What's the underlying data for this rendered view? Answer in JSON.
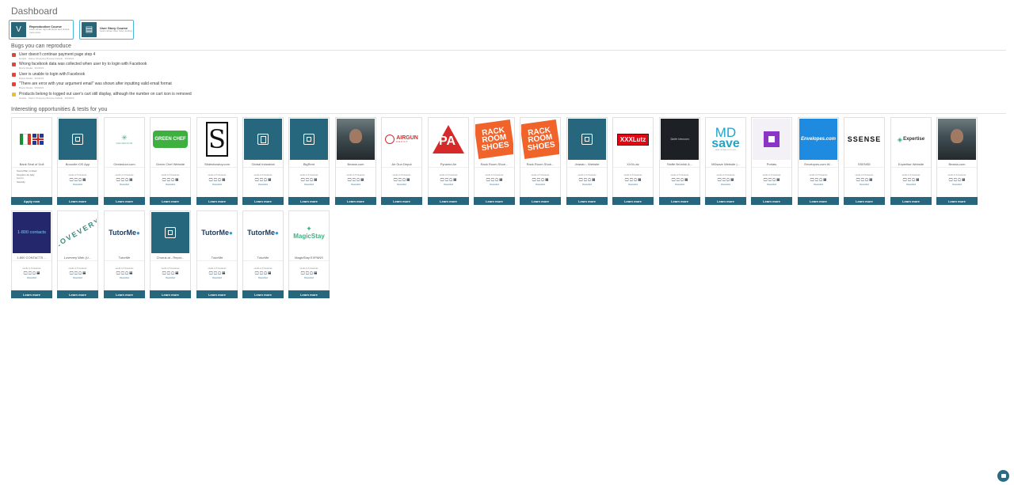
{
  "page": {
    "title": "Dashboard"
  },
  "courses": [
    {
      "name": "Reproduction Course",
      "desc": "Learn about reproductions and unlock more tests",
      "icon": "v-logo-icon"
    },
    {
      "name": "User Story Course",
      "desc": "Learn about User Story testing",
      "icon": "id-card-icon"
    }
  ],
  "bugs_section": {
    "heading": "Bugs you can reproduce",
    "items": [
      {
        "text": "User doesn't continue payment page step 4",
        "meta": "Details · Native Shopping Browse Default · 6/6/2023",
        "severity": "red"
      },
      {
        "text": "Wrong facebook data was collected when user try to login with Facebook",
        "meta": "Brand Media · 6/6/2023",
        "severity": "red"
      },
      {
        "text": "User is unable to login with Facebook",
        "meta": "Brand Media · 6/6/2023",
        "severity": "red"
      },
      {
        "text": "\"There are error with your argument email\" was shown after inputting valid email format",
        "meta": "Brand Media · 6/6/2023",
        "severity": "red"
      },
      {
        "text": "Products belong to logged out user's cart still display, although the number on cart icon is removed",
        "meta": "Details · Native Shopping Browse Default · 6/6/2023",
        "severity": "yellow"
      }
    ]
  },
  "opportunities_section": {
    "heading": "Interesting opportunities & tests for you",
    "tiles": [
      {
        "name": "Bank Seal of Doll",
        "logo": "flags",
        "button": "Apply now"
      },
      {
        "name": "Booodle iOS App",
        "logo": "placeholder",
        "button": "Learn more"
      },
      {
        "name": "Geniedoor.com",
        "logo": "geniedoor",
        "button": "Learn more"
      },
      {
        "name": "Green Chef Website",
        "logo": "greenchef",
        "button": "Learn more"
      },
      {
        "name": "Slideshowtoy.com",
        "logo": "s",
        "button": "Learn more"
      },
      {
        "name": "Global Industrial",
        "logo": "placeholder2",
        "button": "Learn more"
      },
      {
        "name": "BigRent",
        "logo": "placeholder",
        "button": "Learn more"
      },
      {
        "name": "Beaxia.com",
        "logo": "photo",
        "button": "Learn more"
      },
      {
        "name": "Air Gun Depot",
        "logo": "airgun",
        "button": "Learn more"
      },
      {
        "name": "Pyramid Air",
        "logo": "pyramid",
        "button": "Learn more"
      },
      {
        "name": "Rack Room Shoe...",
        "logo": "rackroom",
        "button": "Learn more"
      },
      {
        "name": "Rack Room Shoe...",
        "logo": "rackroom",
        "button": "Learn more"
      },
      {
        "name": "Jeanau - Website",
        "logo": "placeholder",
        "button": "Learn more"
      },
      {
        "name": "XXXLutz",
        "logo": "xxxlutz",
        "button": "Learn more"
      },
      {
        "name": "Stoffe Brünink &...",
        "logo": "stoffe",
        "button": "Learn more"
      },
      {
        "name": "MDsave Website |...",
        "logo": "mdsave",
        "button": "Learn more"
      },
      {
        "name": "Portals",
        "logo": "portals",
        "button": "Learn more"
      },
      {
        "name": "Envelopes.com W...",
        "logo": "envelopes",
        "button": "Learn more"
      },
      {
        "name": "SSENSE",
        "logo": "ssense",
        "button": "Learn more"
      },
      {
        "name": "Expertise Website",
        "logo": "expertise",
        "button": "Learn more"
      },
      {
        "name": "Beaxia.com",
        "logo": "photo",
        "button": "Learn more"
      },
      {
        "name": "1-800 CONTACTS ...",
        "logo": "contacts",
        "button": "Learn more"
      },
      {
        "name": "Lovevery Web (U...",
        "logo": "lovevery",
        "button": "Learn more"
      },
      {
        "name": "TutorMe",
        "logo": "tutorme",
        "button": "Learn more"
      },
      {
        "name": "Chorus.ai - Repor...",
        "logo": "placeholder",
        "button": "Learn more"
      },
      {
        "name": "TutorMe",
        "logo": "tutorme",
        "button": "Learn more"
      },
      {
        "name": "TutorMe",
        "logo": "tutorme",
        "button": "Learn more"
      },
      {
        "name": "MagicStay EXPANS",
        "logo": "magicstay",
        "button": "Learn more"
      }
    ],
    "first_tile_details": [
      "Sound Bar, Limited",
      "Kingdom de Italy",
      "Lion in",
      "Swissity"
    ],
    "tile_small_text": "sends to 5 Features",
    "tile_devices": "🖵 ☐ ▢ ▤",
    "tile_tag": "Rewarded"
  },
  "logos": {
    "greenchef": "GREEN CHEF",
    "airgun": "AIRGUN",
    "airgun_sub": "DEPOT",
    "pyramid": "PA",
    "rackroom": "RACK ROOM SHOES",
    "xxxlutz": "XXXLutz",
    "stoffe": "Stoffe Hemmen",
    "mdsave_top": "MD",
    "mdsave_bottom": "save",
    "mdsave_tag": "HEALTHCARE FOR LESS",
    "envelopes": "Envelopes.com",
    "ssense": "SSENSE",
    "expertise": "Expertise",
    "contacts": "1-800 contacts",
    "lovevery": "LOVEVERY",
    "tutorme": "TutorMe",
    "magicstay": "MagicStay",
    "geniedoor": "GENIEDOOR"
  },
  "colors": {
    "accent": "#27677e",
    "course_border": "#49b6dc",
    "bug_red": "#e0453b",
    "bug_yellow": "#e8c22a"
  }
}
